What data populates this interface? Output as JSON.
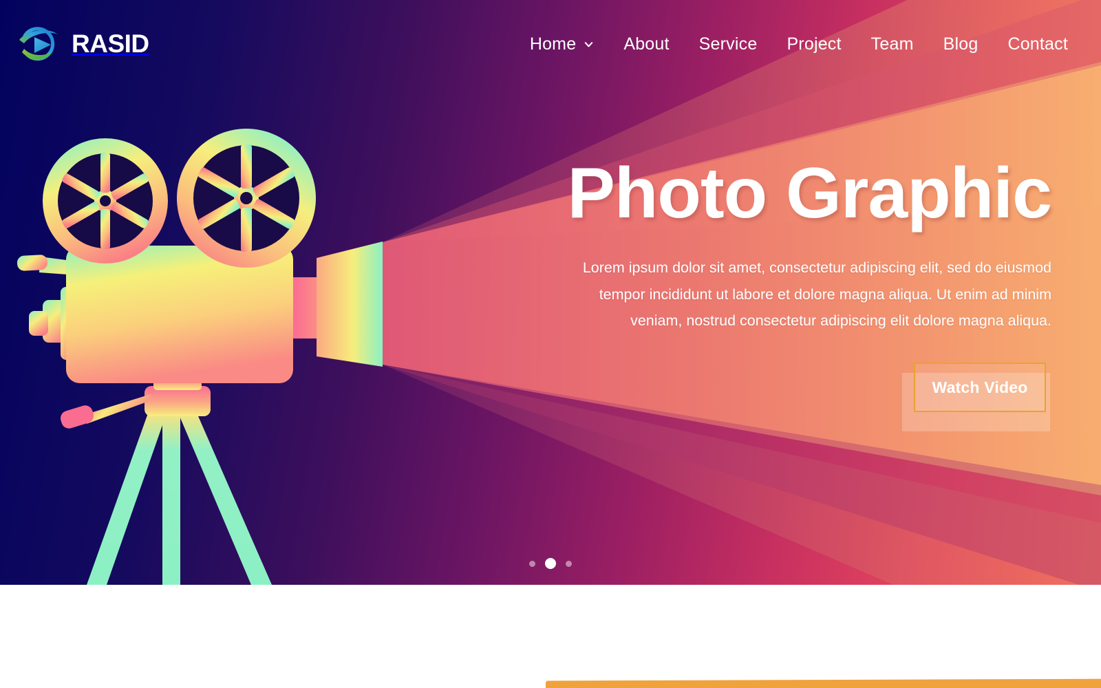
{
  "brand": {
    "name": "RASID",
    "logo_icon": "play-circle-swoosh-logo",
    "colors": {
      "play": "#2f9fe0",
      "swoosh_blue": "#1c7fc4",
      "swoosh_green": "#6cbe45"
    }
  },
  "nav": {
    "items": [
      {
        "label": "Home",
        "has_dropdown": true,
        "caret_icon": "chevron-down-icon"
      },
      {
        "label": "About",
        "has_dropdown": false
      },
      {
        "label": "Service",
        "has_dropdown": false
      },
      {
        "label": "Project",
        "has_dropdown": false
      },
      {
        "label": "Team",
        "has_dropdown": false
      },
      {
        "label": "Blog",
        "has_dropdown": false
      },
      {
        "label": "Contact",
        "has_dropdown": false
      }
    ]
  },
  "hero": {
    "title": "Photo Graphic",
    "description": "Lorem ipsum dolor sit amet, consectetur adipiscing elit, sed do eiusmod tempor incididunt ut labore et dolore magna aliqua. Ut enim ad minim veniam, nostrud consectetur adipiscing elit dolore magna aliqua.",
    "cta_label": "Watch Video",
    "illustration": "movie-projector-on-tripod",
    "colors": {
      "bg_start": "#02025e",
      "bg_mid": "#9c1f63",
      "bg_end": "#f2615c",
      "beam_bright": "#f6a06a",
      "beam_pink": "#ef6f73",
      "cta_border": "#e8a42e",
      "title_text": "#ffffff"
    }
  },
  "slider": {
    "dots": [
      {
        "active": false
      },
      {
        "active": true
      },
      {
        "active": false
      }
    ],
    "current_slide": 2,
    "total_slides": 3
  },
  "below_hero": {
    "accent_bar_color": "#f0a23c"
  }
}
